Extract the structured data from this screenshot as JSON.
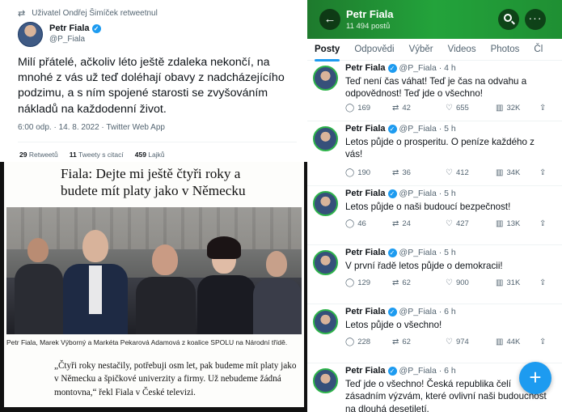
{
  "tweet": {
    "retweet_note": "Uživatel Ondřej Šimíček retweetnul",
    "name": "Petr Fiala",
    "handle": "@P_Fiala",
    "text": "Milí přátelé, ačkoliv léto ještě zdaleka nekončí, na mnohé z vás už teď doléhají obavy z nadcházejícího podzimu, a s ním spojené starosti se zvyšováním nákladů na každodenní život.",
    "meta": "6:00 odp. · 14. 8. 2022 · Twitter Web App",
    "retweets_count": "29",
    "retweets_label": "Retweetů",
    "quotes_count": "11",
    "quotes_label": "Tweety s citací",
    "likes_count": "459",
    "likes_label": "Lajků"
  },
  "news": {
    "headline": "Fiala: Dejte mi ještě čtyři roky a budete mít platy jako v Německu",
    "caption": "Petr Fiala, Marek Výborný a Markéta Pekarová Adamová z koalice SPOLU na Národní třídě.",
    "quote": "„Čtyři roky nestačily, potřebuji osm let, pak budeme mít platy jako v Německu a špičkové univerzity a firmy. Už nebudeme žádná montovna,“ řekl Fiala v České televizi."
  },
  "profile": {
    "name": "Petr Fiala",
    "post_count": "11 494 postů",
    "header_color": "#23a33b",
    "tabs": [
      "Posty",
      "Odpovědi",
      "Výběr",
      "Videos",
      "Photos",
      "Čl"
    ],
    "active_tab": "Posty",
    "posts": [
      {
        "name": "Petr Fiala",
        "handle": "@P_Fiala · 4 h",
        "text": "Teď není čas váhat! Teď je čas na odvahu a odpovědnost! Teď jde o všechno!",
        "replies": "169",
        "reposts": "42",
        "likes": "655",
        "views": "32K"
      },
      {
        "name": "Petr Fiala",
        "handle": "@P_Fiala · 5 h",
        "text": "Letos půjde o prosperitu. O peníze každého z vás!",
        "replies": "190",
        "reposts": "36",
        "likes": "412",
        "views": "34K"
      },
      {
        "name": "Petr Fiala",
        "handle": "@P_Fiala · 5 h",
        "text": "Letos půjde o naši budoucí bezpečnost!",
        "replies": "46",
        "reposts": "24",
        "likes": "427",
        "views": "13K"
      },
      {
        "name": "Petr Fiala",
        "handle": "@P_Fiala · 5 h",
        "text": "V první řadě letos půjde o demokracii!",
        "replies": "129",
        "reposts": "62",
        "likes": "900",
        "views": "31K"
      },
      {
        "name": "Petr Fiala",
        "handle": "@P_Fiala · 6 h",
        "text": "Letos půjde o všechno!",
        "replies": "228",
        "reposts": "62",
        "likes": "974",
        "views": "44K"
      },
      {
        "name": "Petr Fiala",
        "handle": "@P_Fiala · 6 h",
        "text": "Teď jde o všechno! Česká republika čelí zásadním výzvám, které ovlivní naši budoucnost na dlouhá desetiletí."
      }
    ]
  }
}
